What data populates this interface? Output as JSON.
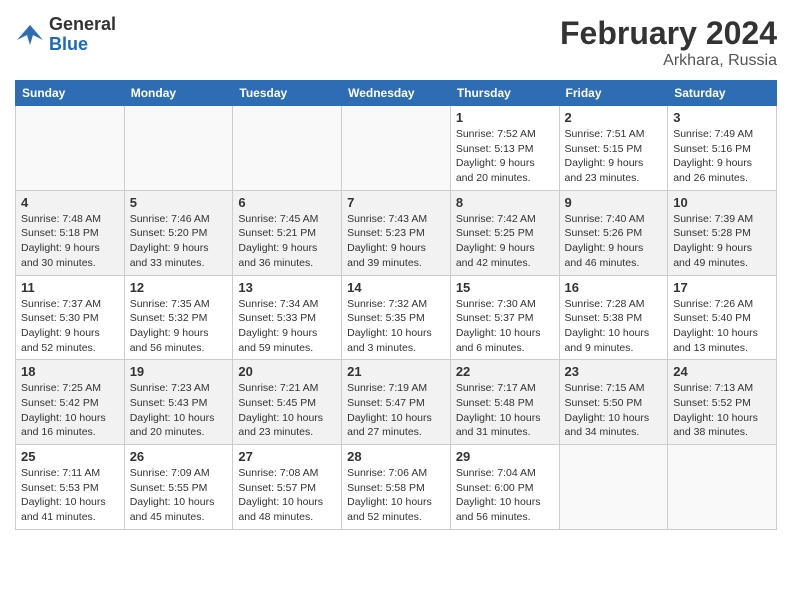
{
  "header": {
    "logo_text_general": "General",
    "logo_text_blue": "Blue",
    "month": "February 2024",
    "location": "Arkhara, Russia"
  },
  "days_of_week": [
    "Sunday",
    "Monday",
    "Tuesday",
    "Wednesday",
    "Thursday",
    "Friday",
    "Saturday"
  ],
  "weeks": [
    {
      "alt": false,
      "days": [
        {
          "num": "",
          "info": "",
          "empty": true
        },
        {
          "num": "",
          "info": "",
          "empty": true
        },
        {
          "num": "",
          "info": "",
          "empty": true
        },
        {
          "num": "",
          "info": "",
          "empty": true
        },
        {
          "num": "1",
          "info": "Sunrise: 7:52 AM\nSunset: 5:13 PM\nDaylight: 9 hours\nand 20 minutes.",
          "empty": false
        },
        {
          "num": "2",
          "info": "Sunrise: 7:51 AM\nSunset: 5:15 PM\nDaylight: 9 hours\nand 23 minutes.",
          "empty": false
        },
        {
          "num": "3",
          "info": "Sunrise: 7:49 AM\nSunset: 5:16 PM\nDaylight: 9 hours\nand 26 minutes.",
          "empty": false
        }
      ]
    },
    {
      "alt": true,
      "days": [
        {
          "num": "4",
          "info": "Sunrise: 7:48 AM\nSunset: 5:18 PM\nDaylight: 9 hours\nand 30 minutes.",
          "empty": false
        },
        {
          "num": "5",
          "info": "Sunrise: 7:46 AM\nSunset: 5:20 PM\nDaylight: 9 hours\nand 33 minutes.",
          "empty": false
        },
        {
          "num": "6",
          "info": "Sunrise: 7:45 AM\nSunset: 5:21 PM\nDaylight: 9 hours\nand 36 minutes.",
          "empty": false
        },
        {
          "num": "7",
          "info": "Sunrise: 7:43 AM\nSunset: 5:23 PM\nDaylight: 9 hours\nand 39 minutes.",
          "empty": false
        },
        {
          "num": "8",
          "info": "Sunrise: 7:42 AM\nSunset: 5:25 PM\nDaylight: 9 hours\nand 42 minutes.",
          "empty": false
        },
        {
          "num": "9",
          "info": "Sunrise: 7:40 AM\nSunset: 5:26 PM\nDaylight: 9 hours\nand 46 minutes.",
          "empty": false
        },
        {
          "num": "10",
          "info": "Sunrise: 7:39 AM\nSunset: 5:28 PM\nDaylight: 9 hours\nand 49 minutes.",
          "empty": false
        }
      ]
    },
    {
      "alt": false,
      "days": [
        {
          "num": "11",
          "info": "Sunrise: 7:37 AM\nSunset: 5:30 PM\nDaylight: 9 hours\nand 52 minutes.",
          "empty": false
        },
        {
          "num": "12",
          "info": "Sunrise: 7:35 AM\nSunset: 5:32 PM\nDaylight: 9 hours\nand 56 minutes.",
          "empty": false
        },
        {
          "num": "13",
          "info": "Sunrise: 7:34 AM\nSunset: 5:33 PM\nDaylight: 9 hours\nand 59 minutes.",
          "empty": false
        },
        {
          "num": "14",
          "info": "Sunrise: 7:32 AM\nSunset: 5:35 PM\nDaylight: 10 hours\nand 3 minutes.",
          "empty": false
        },
        {
          "num": "15",
          "info": "Sunrise: 7:30 AM\nSunset: 5:37 PM\nDaylight: 10 hours\nand 6 minutes.",
          "empty": false
        },
        {
          "num": "16",
          "info": "Sunrise: 7:28 AM\nSunset: 5:38 PM\nDaylight: 10 hours\nand 9 minutes.",
          "empty": false
        },
        {
          "num": "17",
          "info": "Sunrise: 7:26 AM\nSunset: 5:40 PM\nDaylight: 10 hours\nand 13 minutes.",
          "empty": false
        }
      ]
    },
    {
      "alt": true,
      "days": [
        {
          "num": "18",
          "info": "Sunrise: 7:25 AM\nSunset: 5:42 PM\nDaylight: 10 hours\nand 16 minutes.",
          "empty": false
        },
        {
          "num": "19",
          "info": "Sunrise: 7:23 AM\nSunset: 5:43 PM\nDaylight: 10 hours\nand 20 minutes.",
          "empty": false
        },
        {
          "num": "20",
          "info": "Sunrise: 7:21 AM\nSunset: 5:45 PM\nDaylight: 10 hours\nand 23 minutes.",
          "empty": false
        },
        {
          "num": "21",
          "info": "Sunrise: 7:19 AM\nSunset: 5:47 PM\nDaylight: 10 hours\nand 27 minutes.",
          "empty": false
        },
        {
          "num": "22",
          "info": "Sunrise: 7:17 AM\nSunset: 5:48 PM\nDaylight: 10 hours\nand 31 minutes.",
          "empty": false
        },
        {
          "num": "23",
          "info": "Sunrise: 7:15 AM\nSunset: 5:50 PM\nDaylight: 10 hours\nand 34 minutes.",
          "empty": false
        },
        {
          "num": "24",
          "info": "Sunrise: 7:13 AM\nSunset: 5:52 PM\nDaylight: 10 hours\nand 38 minutes.",
          "empty": false
        }
      ]
    },
    {
      "alt": false,
      "days": [
        {
          "num": "25",
          "info": "Sunrise: 7:11 AM\nSunset: 5:53 PM\nDaylight: 10 hours\nand 41 minutes.",
          "empty": false
        },
        {
          "num": "26",
          "info": "Sunrise: 7:09 AM\nSunset: 5:55 PM\nDaylight: 10 hours\nand 45 minutes.",
          "empty": false
        },
        {
          "num": "27",
          "info": "Sunrise: 7:08 AM\nSunset: 5:57 PM\nDaylight: 10 hours\nand 48 minutes.",
          "empty": false
        },
        {
          "num": "28",
          "info": "Sunrise: 7:06 AM\nSunset: 5:58 PM\nDaylight: 10 hours\nand 52 minutes.",
          "empty": false
        },
        {
          "num": "29",
          "info": "Sunrise: 7:04 AM\nSunset: 6:00 PM\nDaylight: 10 hours\nand 56 minutes.",
          "empty": false
        },
        {
          "num": "",
          "info": "",
          "empty": true
        },
        {
          "num": "",
          "info": "",
          "empty": true
        }
      ]
    }
  ]
}
